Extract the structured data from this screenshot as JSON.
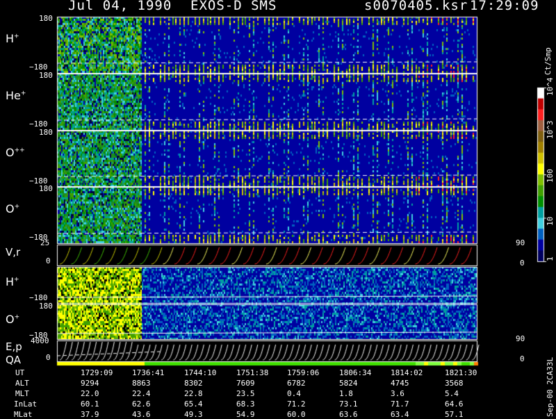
{
  "header": {
    "date": "Jul 04, 1990",
    "instrument": "EXOS-D SMS",
    "file": "s0070405.ksr",
    "time": "17:29:09"
  },
  "colorbar": {
    "unit": "Ct/Smp",
    "ticks": [
      "10^4",
      "10^3",
      "100",
      "10",
      "1"
    ],
    "colors": [
      "#ffffff",
      "#c00000",
      "#ff2020",
      "#a06040",
      "#806010",
      "#a08000",
      "#d0c000",
      "#ffff00",
      "#80c000",
      "#40a000",
      "#009000",
      "#00a0a0",
      "#40d0e0",
      "#0060c0",
      "#0000a0",
      "#000060"
    ]
  },
  "chart_data": [
    {
      "type": "heatmap",
      "panels": [
        {
          "id": "h-plus",
          "label": "H",
          "charge": "+",
          "ymax": "180",
          "ymin": "−180"
        },
        {
          "id": "he-plus",
          "label": "He",
          "charge": "+",
          "ymax": "180",
          "ymin": "−180"
        },
        {
          "id": "o-plus-plus",
          "label": "O",
          "charge": "++",
          "ymax": "180",
          "ymin": "−180"
        },
        {
          "id": "o-plus",
          "label": "O",
          "charge": "+",
          "ymax": "180",
          "ymin": "−180"
        }
      ],
      "colorscale": "log counts 1 to 10^4 (Ct/Smp)"
    },
    {
      "type": "line",
      "label": "V,r",
      "yleft": [
        "25",
        "0"
      ],
      "yright": [
        "90",
        "0"
      ]
    },
    {
      "type": "heatmap",
      "panels": [
        {
          "id": "h-plus-2",
          "label": "H",
          "charge": "+",
          "ymax": "",
          "ymin": "−180"
        },
        {
          "id": "o-plus-2",
          "label": "O",
          "charge": "+",
          "ymax": "180",
          "ymin": "−180"
        }
      ]
    },
    {
      "type": "line",
      "label_top": "E,p",
      "label_bottom": "QA",
      "yleft": [
        "4000",
        "0"
      ],
      "yright": [
        "90",
        "0"
      ]
    }
  ],
  "ephemeris": {
    "rows": [
      {
        "name": "UT",
        "values": [
          "1729:09",
          "1736:41",
          "1744:10",
          "1751:38",
          "1759:06",
          "1806:34",
          "1814:02",
          "1821:30"
        ]
      },
      {
        "name": "ALT",
        "values": [
          "9294",
          "8863",
          "8302",
          "7609",
          "6782",
          "5824",
          "4745",
          "3568"
        ]
      },
      {
        "name": "MLT",
        "values": [
          "22.0",
          "22.4",
          "22.8",
          "23.5",
          "0.4",
          "1.8",
          "3.6",
          "5.4"
        ]
      },
      {
        "name": "InLat",
        "values": [
          "60.1",
          "62.6",
          "65.4",
          "68.3",
          "71.2",
          "73.1",
          "71.7",
          "64.6"
        ]
      },
      {
        "name": "MLat",
        "values": [
          "37.9",
          "43.6",
          "49.3",
          "54.9",
          "60.0",
          "63.6",
          "63.4",
          "57.1"
        ]
      }
    ]
  },
  "footer_id": "Sep-00  2CA33L"
}
